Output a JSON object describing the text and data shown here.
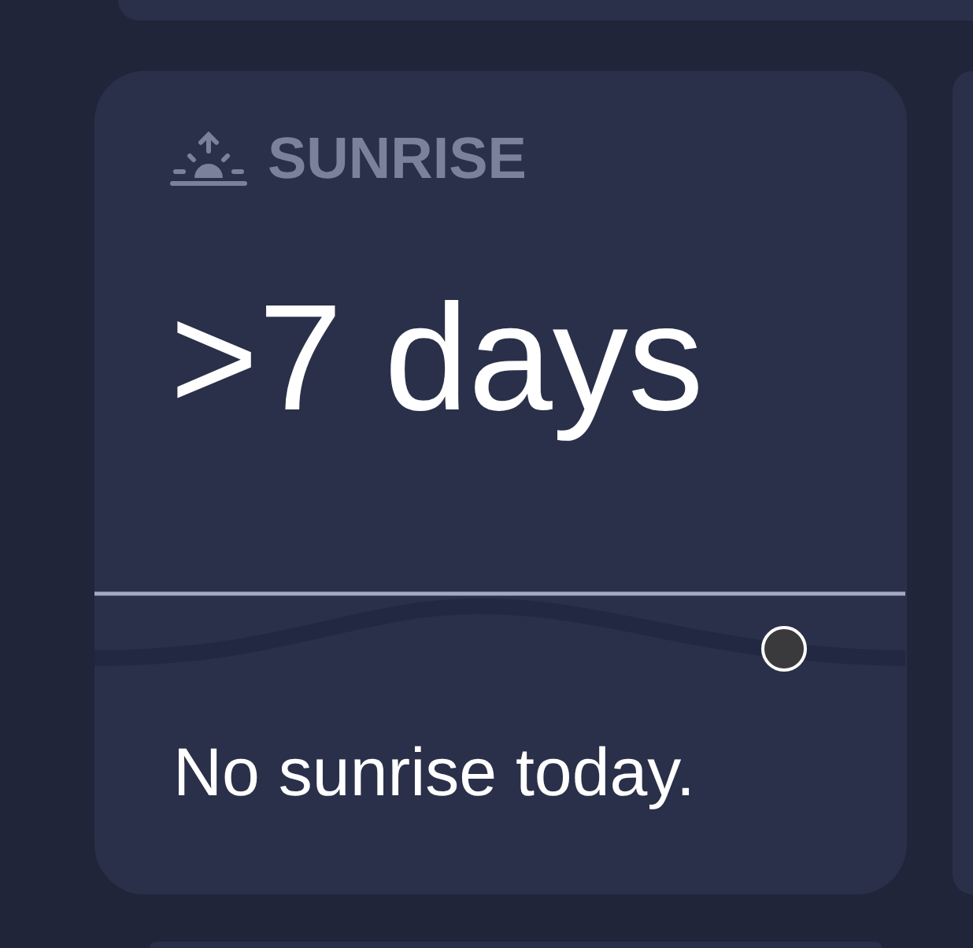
{
  "widget": {
    "title": "SUNRISE",
    "value": ">7 days",
    "caption": "No sunrise today."
  }
}
